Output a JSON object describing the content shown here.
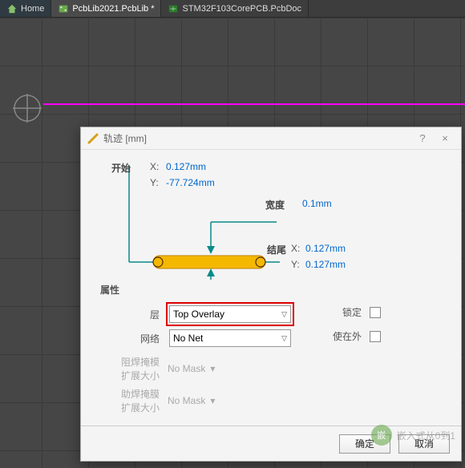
{
  "tabs": {
    "home": "Home",
    "pcblib": "PcbLib2021.PcbLib *",
    "pcbdoc": "STM32F103CorePCB.PcbDoc"
  },
  "dialog": {
    "title": "轨迹 [mm]",
    "help": "?",
    "close": "×",
    "start_label": "开始",
    "start_x_label": "X:",
    "start_x": "0.127mm",
    "start_y_label": "Y:",
    "start_y": "-77.724mm",
    "width_label": "宽度",
    "width": "0.1mm",
    "end_label": "结尾",
    "end_x_label": "X:",
    "end_x": "0.127mm",
    "end_y_label": "Y:",
    "end_y": "0.127mm",
    "section_props": "属性",
    "layer_label": "层",
    "layer_value": "Top Overlay",
    "net_label": "网络",
    "net_value": "No Net",
    "lock_label": "锁定",
    "keepout_label": "使在外",
    "soldermask_label1": "阻焊掩模",
    "soldermask_label2": "扩展大小",
    "soldermask_value": "No Mask",
    "pastemask_label1": "助焊掩膜",
    "pastemask_label2": "扩展大小",
    "pastemask_value": "No Mask",
    "ok": "确定",
    "cancel": "取消"
  },
  "watermark": {
    "logo": "嵌",
    "text": "嵌入式从0到1"
  }
}
